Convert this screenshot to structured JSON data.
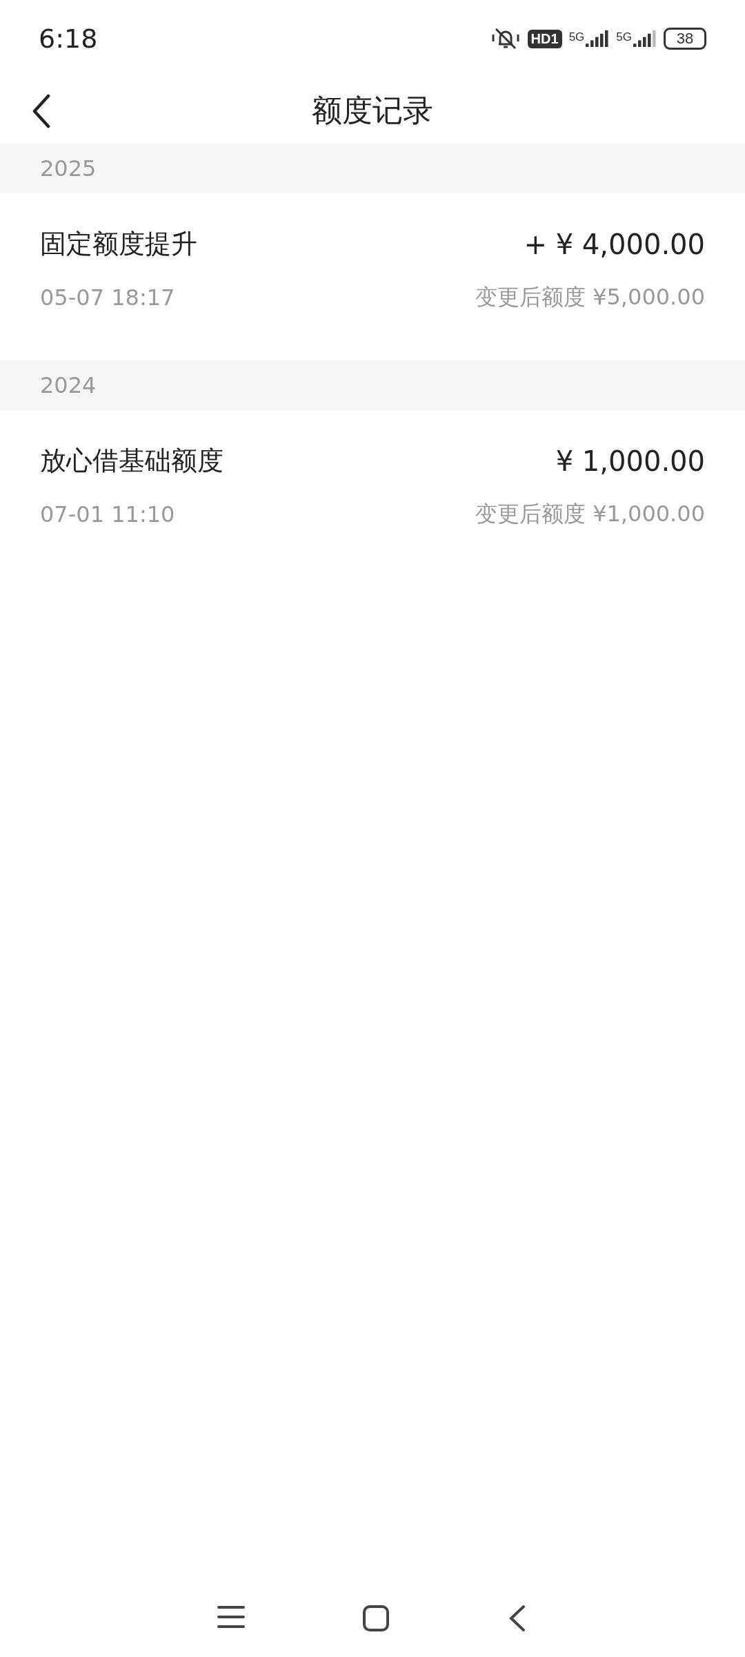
{
  "status_bar": {
    "time": "6:18",
    "hd_badge": "HD1",
    "signals": [
      {
        "network": "5G"
      },
      {
        "network": "5G"
      }
    ],
    "battery": "38"
  },
  "header": {
    "title": "额度记录"
  },
  "groups": [
    {
      "year": "2025",
      "records": [
        {
          "title": "固定额度提升",
          "amount": "+ ¥ 4,000.00",
          "time": "05-07 18:17",
          "after": "变更后额度 ¥5,000.00"
        }
      ]
    },
    {
      "year": "2024",
      "records": [
        {
          "title": "放心借基础额度",
          "amount": "¥ 1,000.00",
          "time": "07-01 11:10",
          "after": "变更后额度 ¥1,000.00"
        }
      ]
    }
  ]
}
